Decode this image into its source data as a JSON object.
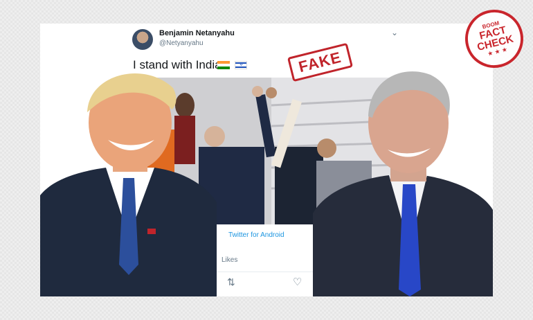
{
  "tweet": {
    "author_name": "Benjamin Netanyahu",
    "author_handle": "@Netyanyahu",
    "text": "I stand with India",
    "flags": [
      "india-flag",
      "israel-flag"
    ],
    "source": "Twitter for Android",
    "likes_label": "Likes",
    "icons": [
      "chevron-down-icon",
      "retweet-icon",
      "heart-icon"
    ]
  },
  "overlays": {
    "fake_stamp": "FAKE",
    "badge": {
      "brand": "BOOM",
      "line1": "FACT",
      "line2": "CHECK",
      "stars": "★ ★ ★"
    }
  },
  "colors": {
    "stamp_red": "#c0242b",
    "link_blue": "#1b95e0",
    "text_dark": "#14171a",
    "text_muted": "#657786"
  }
}
